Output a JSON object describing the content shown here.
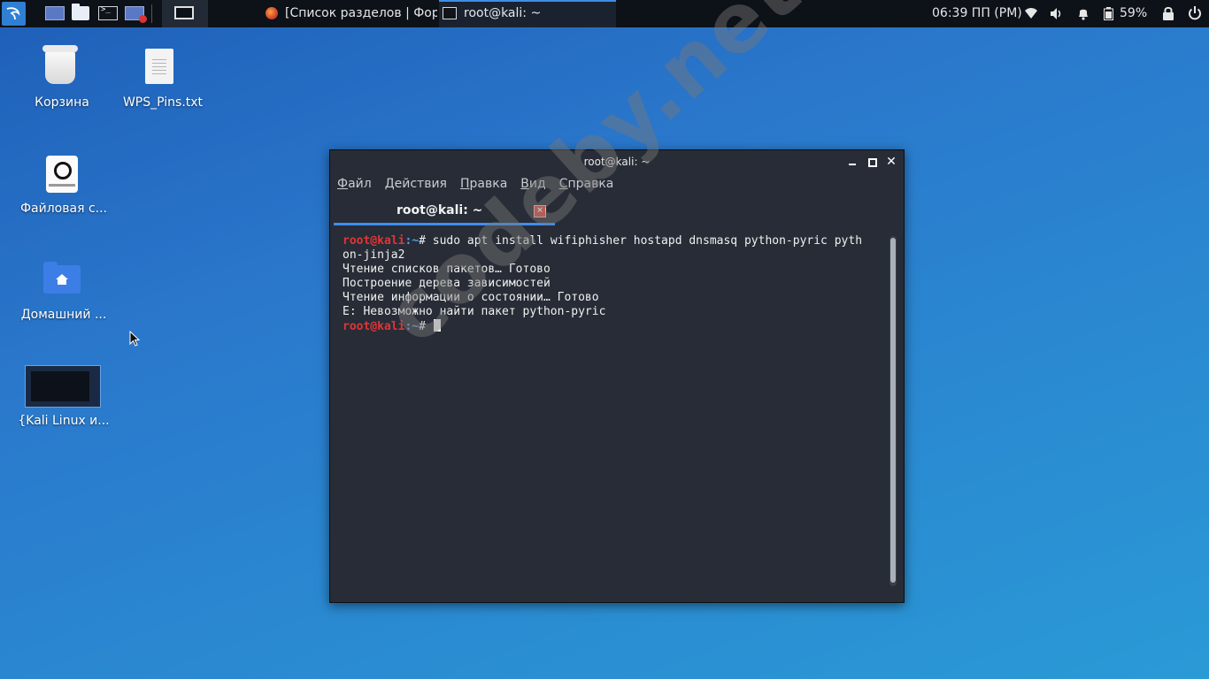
{
  "panel": {
    "tasks": [
      {
        "title": "[Список разделов | Фор..."
      },
      {
        "title": "root@kali: ~"
      }
    ],
    "clock": "06:39 ПП (PM)",
    "battery": "59%"
  },
  "desktop": {
    "icons": [
      {
        "label": "Корзина"
      },
      {
        "label": "WPS_Pins.txt"
      },
      {
        "label": "Файловая с..."
      },
      {
        "label": "Домашний ..."
      },
      {
        "label": "{Kali Linux и..."
      }
    ]
  },
  "window": {
    "title": "root@kali: ~",
    "menu": [
      "Файл",
      "Действия",
      "Правка",
      "Вид",
      "Справка"
    ],
    "tab_label": "root@kali: ~",
    "prompt_user": "root@kali",
    "prompt_path": ":~",
    "prompt_sym": "# ",
    "command": "sudo apt install wifiphisher hostapd dnsmasq python-pyric pyth",
    "command_cont": "on-jinja2",
    "output": [
      "Чтение списков пакетов… Готово",
      "Построение дерева зависимостей",
      "Чтение информации о состоянии… Готово",
      "E: Невозможно найти пакет python-pyric"
    ]
  },
  "watermark": "codeby.net",
  "colors": {
    "accent": "#3d8ff0",
    "prompt_user": "#e03535",
    "prompt_path": "#5f9be8",
    "terminal_bg": "#272c36"
  }
}
